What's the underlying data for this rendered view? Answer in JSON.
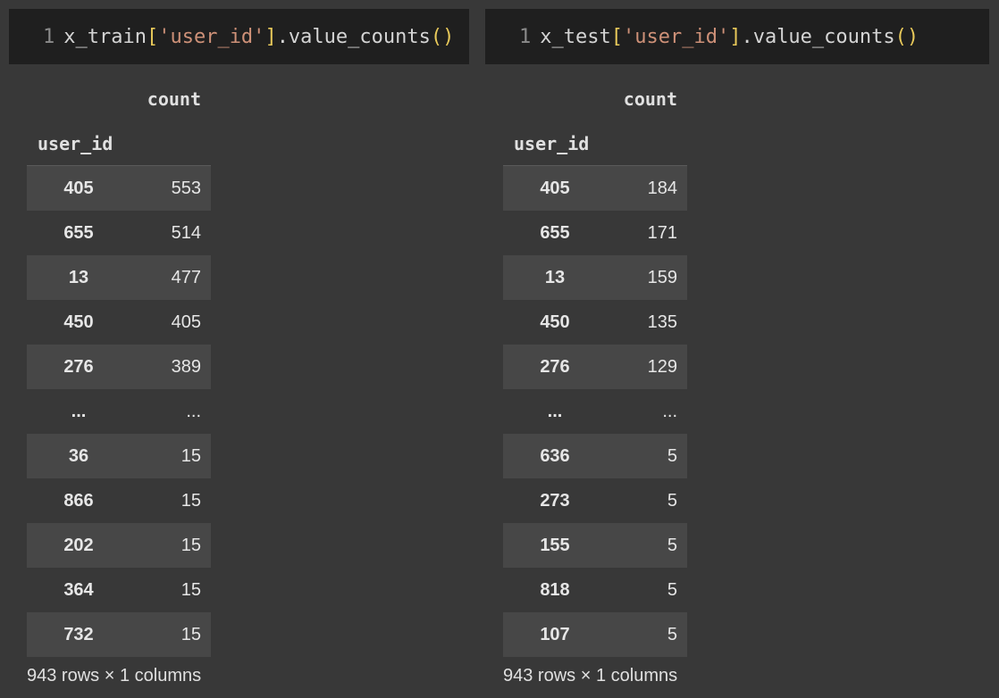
{
  "cells": [
    {
      "line_number": "1",
      "code": {
        "var": "x_train",
        "open_bracket": "[",
        "string": "'user_id'",
        "close_bracket": "]",
        "method": ".value_counts",
        "parens": "()"
      },
      "output": {
        "column_header": "count",
        "index_name": "user_id",
        "rows": [
          {
            "index": "405",
            "value": "553"
          },
          {
            "index": "655",
            "value": "514"
          },
          {
            "index": "13",
            "value": "477"
          },
          {
            "index": "450",
            "value": "405"
          },
          {
            "index": "276",
            "value": "389"
          },
          {
            "index": "...",
            "value": "..."
          },
          {
            "index": "36",
            "value": "15"
          },
          {
            "index": "866",
            "value": "15"
          },
          {
            "index": "202",
            "value": "15"
          },
          {
            "index": "364",
            "value": "15"
          },
          {
            "index": "732",
            "value": "15"
          }
        ],
        "footer": "943 rows × 1 columns"
      }
    },
    {
      "line_number": "1",
      "code": {
        "var": "x_test",
        "open_bracket": "[",
        "string": "'user_id'",
        "close_bracket": "]",
        "method": ".value_counts",
        "parens": "()"
      },
      "output": {
        "column_header": "count",
        "index_name": "user_id",
        "rows": [
          {
            "index": "405",
            "value": "184"
          },
          {
            "index": "655",
            "value": "171"
          },
          {
            "index": "13",
            "value": "159"
          },
          {
            "index": "450",
            "value": "135"
          },
          {
            "index": "276",
            "value": "129"
          },
          {
            "index": "...",
            "value": "..."
          },
          {
            "index": "636",
            "value": "5"
          },
          {
            "index": "273",
            "value": "5"
          },
          {
            "index": "155",
            "value": "5"
          },
          {
            "index": "818",
            "value": "5"
          },
          {
            "index": "107",
            "value": "5"
          }
        ],
        "footer": "943 rows × 1 columns"
      }
    }
  ]
}
